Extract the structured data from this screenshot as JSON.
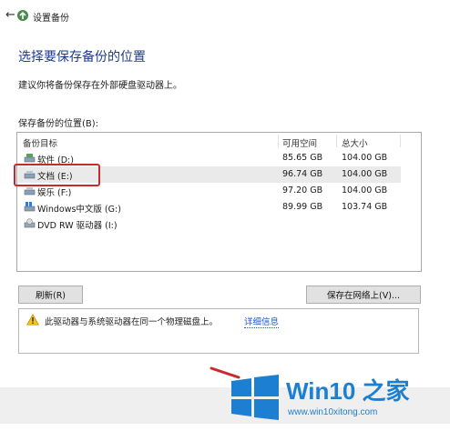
{
  "window": {
    "title": "设置备份"
  },
  "heading": "选择要保存备份的位置",
  "subtext": "建议你将备份保存在外部硬盘驱动器上。",
  "list": {
    "label": "保存备份的位置(B):",
    "columns": {
      "target": "备份目标",
      "available": "可用空间",
      "total": "总大小"
    },
    "rows": [
      {
        "name": "软件 (D:)",
        "available": "85.65 GB",
        "total": "104.00 GB",
        "icon": "drive-icon"
      },
      {
        "name": "文档 (E:)",
        "available": "96.74 GB",
        "total": "104.00 GB",
        "icon": "drive-icon",
        "selected": true
      },
      {
        "name": "娱乐 (F:)",
        "available": "97.20 GB",
        "total": "104.00 GB",
        "icon": "drive-icon"
      },
      {
        "name": "Windows中文版 (G:)",
        "available": "89.99 GB",
        "total": "103.74 GB",
        "icon": "windows-drive-icon"
      },
      {
        "name": "DVD RW 驱动器 (I:)",
        "available": "",
        "total": "",
        "icon": "dvd-drive-icon"
      }
    ]
  },
  "buttons": {
    "refresh": "刷新(R)",
    "save_network": "保存在网络上(V)..."
  },
  "warning": {
    "text": "此驱动器与系统驱动器在同一个物理磁盘上。",
    "link": "详细信息",
    "icon": "warning-icon"
  },
  "watermark": {
    "brand": "Win10 之家",
    "url": "www.win10xitong.com"
  },
  "colors": {
    "heading": "#1e3a8a",
    "highlight": "#c62a2a",
    "brand": "#1c7fd1",
    "link": "#1a56c4"
  }
}
